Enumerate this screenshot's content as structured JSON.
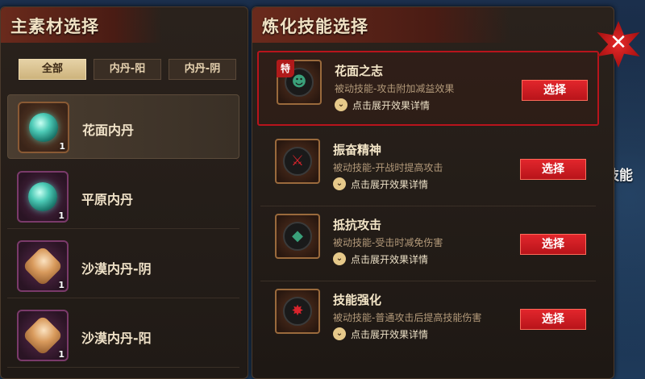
{
  "left_panel": {
    "title": "主素材选择",
    "filters": [
      "全部",
      "内丹-阳",
      "内丹-阴"
    ],
    "materials": [
      {
        "name": "花面内丹",
        "count": "1"
      },
      {
        "name": "平原内丹",
        "count": "1"
      },
      {
        "name": "沙漠内丹-阴",
        "count": "1"
      },
      {
        "name": "沙漠内丹-阳",
        "count": "1"
      }
    ]
  },
  "right_panel": {
    "title": "炼化技能选择",
    "special_tag": "特",
    "expand_label": "点击展开效果详情",
    "select_label": "选择",
    "skills": [
      {
        "name": "花面之志",
        "desc": "被动技能-攻击附加减益效果"
      },
      {
        "name": "振奋精神",
        "desc": "被动技能-开战时提高攻击"
      },
      {
        "name": "抵抗攻击",
        "desc": "被动技能-受击时减免伤害"
      },
      {
        "name": "技能强化",
        "desc": "被动技能-普通攻击后提高技能伤害"
      }
    ]
  },
  "background": {
    "partial_text": "的技能"
  },
  "close_glyph": "✕",
  "colors": {
    "accent_red": "#d8202a",
    "panel_brown": "#2a221c",
    "gold_tab": "#e6d2a6"
  }
}
